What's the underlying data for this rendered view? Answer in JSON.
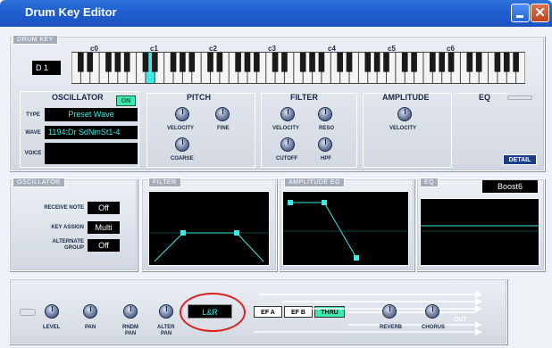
{
  "window": {
    "title": "Drum Key Editor"
  },
  "drum_key": {
    "tab_label": "DRUM KEY",
    "note_display": "D 1",
    "octave_labels": [
      "c0",
      "c1",
      "c2",
      "c3",
      "c4",
      "c5",
      "c6"
    ],
    "selected_key_color": "#3fe8e0"
  },
  "oscillator_top": {
    "header": "OSCILLATOR",
    "on_label": "ON",
    "type_label": "TYPE",
    "type_value": "Preset Wave",
    "wave_label": "WAVE",
    "wave_value": "1194:Dr SdNmSt1-4",
    "voice_label": "VOICE",
    "voice_value": ""
  },
  "pitch": {
    "header": "PITCH",
    "velocity_label": "VELOCITY",
    "fine_label": "FINE",
    "coarse_label": "COARSE"
  },
  "filter": {
    "header": "FILTER",
    "velocity_label": "VELOCITY",
    "reso_label": "RESO",
    "cutoff_label": "CUTOFF",
    "hpf_label": "HPF"
  },
  "amplitude": {
    "header": "AMPLITUDE",
    "velocity_label": "VELOCITY"
  },
  "eq_top": {
    "header": "EQ",
    "detail_label": "DETAIL"
  },
  "oscillator_mid": {
    "tab_label": "OSCILLATOR",
    "receive_note_label": "RECEIVE NOTE",
    "receive_note_value": "Off",
    "key_assign_label": "KEY ASSIGN",
    "key_assign_value": "Multi",
    "alternate_group_label_1": "ALTERNATE",
    "alternate_group_label_2": "GROUP",
    "alternate_group_value": "Off"
  },
  "filter_mid": {
    "tab_label": "FILTER"
  },
  "amp_eg": {
    "tab_label": "AMPLITUDE EG"
  },
  "eq_mid": {
    "tab_label": "EQ",
    "preset_value": "Boost6"
  },
  "output": {
    "level_label": "LEVEL",
    "pan_label": "PAN",
    "rndm_pan_label_1": "RNDM",
    "rndm_pan_label_2": "PAN",
    "alter_pan_label_1": "ALTER",
    "alter_pan_label_2": "PAN",
    "pan_display": "L&R",
    "efa_label": "EF A",
    "efb_label": "EF B",
    "thru_label": "THRU",
    "reverb_label": "REVERB",
    "chorus_label": "CHORUS",
    "out_label": "OUT"
  },
  "colors": {
    "accent": "#3fe8e0",
    "title_bar": "#1f5fd0",
    "highlight_circle": "#e02020",
    "thru_green": "#3fe8b0"
  }
}
